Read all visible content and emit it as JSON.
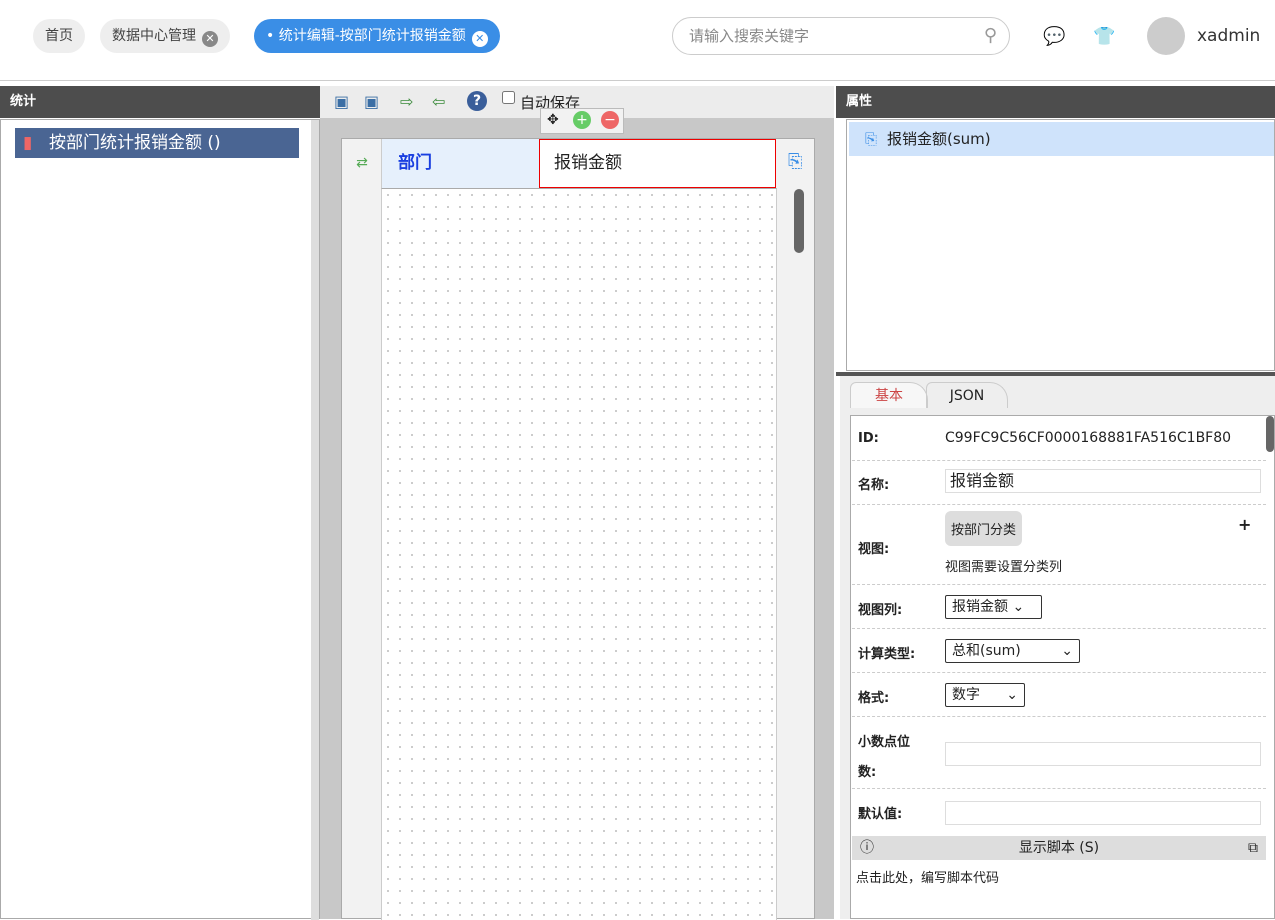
{
  "tabs": [
    {
      "label": "首页"
    },
    {
      "label": "数据中心管理"
    },
    {
      "label": "统计编辑-按部门统计报销金额"
    }
  ],
  "search": {
    "placeholder": "请输入搜索关键字"
  },
  "user": {
    "name": "xadmin"
  },
  "left": {
    "title": "统计",
    "item": "按部门统计报销金额 ()"
  },
  "toolbar": {
    "autosave": "自动保存"
  },
  "grid": {
    "col1": "部门",
    "col2": "报销金额"
  },
  "props": {
    "title": "属性",
    "item": "报销金额(sum)"
  },
  "ptabs": [
    "基本",
    "JSON"
  ],
  "form": {
    "id_label": "ID:",
    "id_value": "C99FC9C56CF0000168881FA516C1BF80",
    "name_label": "名称:",
    "name_value": "报销金额",
    "view_label": "视图:",
    "view_chip": "按部门分类",
    "view_hint": "视图需要设置分类列",
    "view_add": "+",
    "viewcol_label": "视图列:",
    "viewcol_value": "报销金额",
    "calc_label": "计算类型:",
    "calc_value": "总和(sum)",
    "format_label": "格式:",
    "format_value": "数字",
    "decimal_label1": "小数点位",
    "decimal_label2": "数:",
    "default_label": "默认值:"
  },
  "script": {
    "title": "显示脚本 (S)",
    "hint": "点击此处，编写脚本代码"
  }
}
